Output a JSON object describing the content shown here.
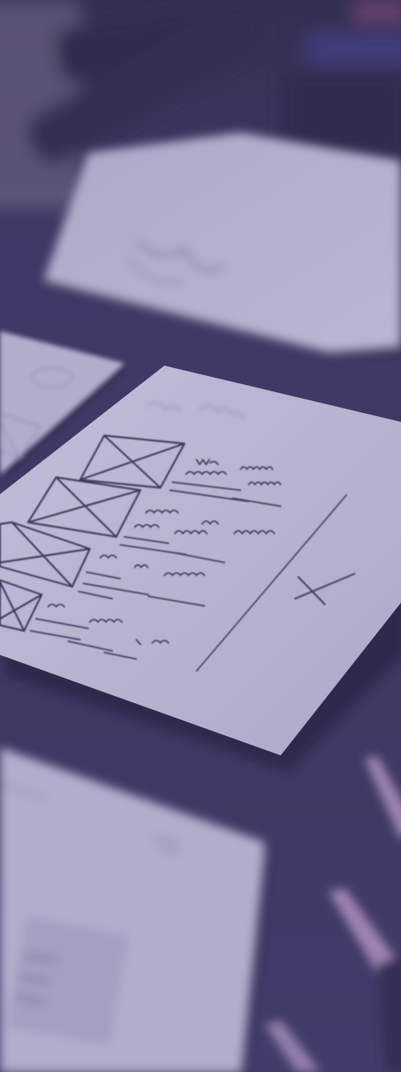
{
  "scene": {
    "description_kind": "photo",
    "subject": "paper-wireframe-sketches",
    "colors": {
      "tint": "#4b4684",
      "desk": "#3b3757",
      "paper": "#d7d5e8",
      "paper_shadow": "#2b2742",
      "ink": "#36324f",
      "pencil_pink": "#b896bf"
    }
  }
}
